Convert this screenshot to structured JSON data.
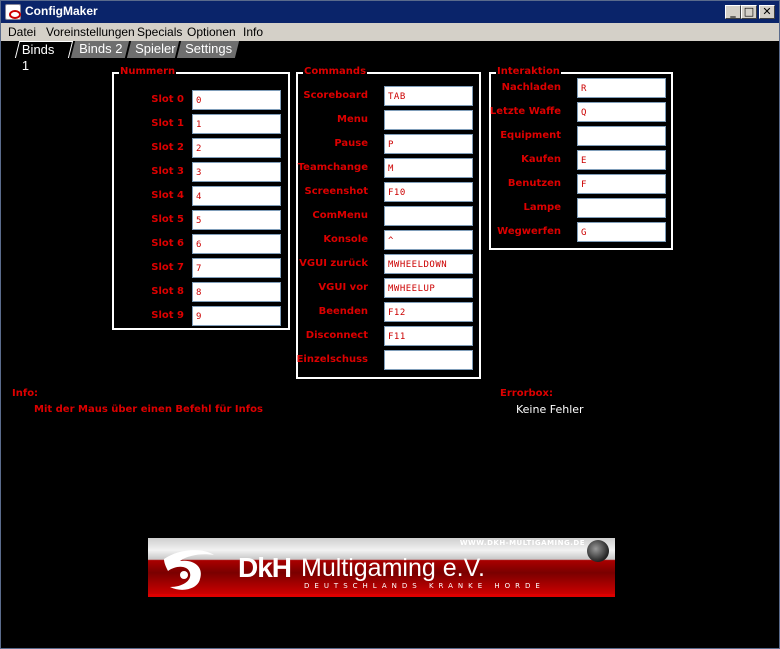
{
  "window": {
    "title": "ConfigMaker",
    "buttons": {
      "minimize": "_",
      "maximize": "□",
      "close": "✕"
    }
  },
  "menu": [
    "Datei",
    "Voreinstellungen",
    "Specials",
    "Optionen",
    "Info"
  ],
  "tabs": [
    "Binds 1",
    "Binds 2",
    "Spieler",
    "Settings"
  ],
  "groups": {
    "nummern": {
      "title": "Nummern",
      "rows": [
        {
          "label": "Slot 0",
          "value": "0"
        },
        {
          "label": "Slot 1",
          "value": "1"
        },
        {
          "label": "Slot 2",
          "value": "2"
        },
        {
          "label": "Slot 3",
          "value": "3"
        },
        {
          "label": "Slot 4",
          "value": "4"
        },
        {
          "label": "Slot 5",
          "value": "5"
        },
        {
          "label": "Slot 6",
          "value": "6"
        },
        {
          "label": "Slot 7",
          "value": "7"
        },
        {
          "label": "Slot 8",
          "value": "8"
        },
        {
          "label": "Slot 9",
          "value": "9"
        }
      ]
    },
    "commands": {
      "title": "Commands",
      "rows": [
        {
          "label": "Scoreboard",
          "value": "TAB"
        },
        {
          "label": "Menu",
          "value": ""
        },
        {
          "label": "Pause",
          "value": "P"
        },
        {
          "label": "Teamchange",
          "value": "M"
        },
        {
          "label": "Screenshot",
          "value": "F10"
        },
        {
          "label": "ComMenu",
          "value": ""
        },
        {
          "label": "Konsole",
          "value": "^"
        },
        {
          "label": "VGUI zurück",
          "value": "MWHEELDOWN"
        },
        {
          "label": "VGUI vor",
          "value": "MWHEELUP"
        },
        {
          "label": "Beenden",
          "value": "F12"
        },
        {
          "label": "Disconnect",
          "value": "F11"
        },
        {
          "label": "Einzelschuss",
          "value": ""
        }
      ]
    },
    "interaktion": {
      "title": "Interaktion",
      "rows": [
        {
          "label": "Nachladen",
          "value": "R"
        },
        {
          "label": "Letzte Waffe",
          "value": "Q"
        },
        {
          "label": "Equipment",
          "value": ""
        },
        {
          "label": "Kaufen",
          "value": "E"
        },
        {
          "label": "Benutzen",
          "value": "F"
        },
        {
          "label": "Lampe",
          "value": ""
        },
        {
          "label": "Wegwerfen",
          "value": "G"
        }
      ]
    }
  },
  "info": {
    "title": "Info:",
    "text": "Mit der Maus über einen Befehl für Infos"
  },
  "errorbox": {
    "title": "Errorbox:",
    "text": "Keine Fehler"
  },
  "banner": {
    "url": "WWW.DKH-MULTIGAMING.DE",
    "brand": "DkH",
    "name": "Multigaming e.V.",
    "tagline": "DEUTSCHLANDS KRANKE HORDE"
  },
  "colors": {
    "accent": "#dd0000",
    "titlebar": "#0a246a",
    "menubar": "#d4d0c8"
  }
}
